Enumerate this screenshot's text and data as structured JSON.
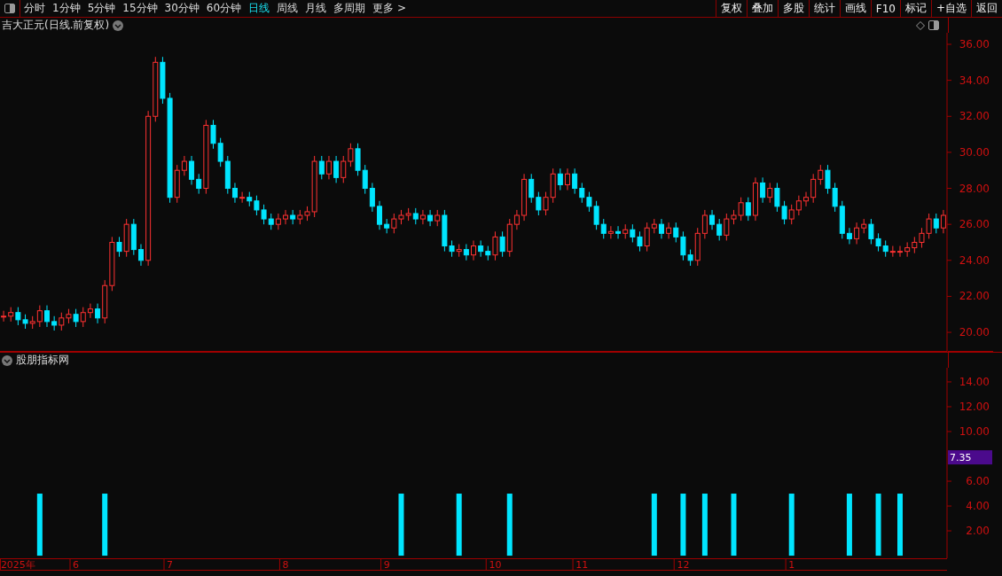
{
  "toolbar": {
    "periods": [
      {
        "label": "分时",
        "selected": false
      },
      {
        "label": "1分钟",
        "selected": false
      },
      {
        "label": "5分钟",
        "selected": false
      },
      {
        "label": "15分钟",
        "selected": false
      },
      {
        "label": "30分钟",
        "selected": false
      },
      {
        "label": "60分钟",
        "selected": false
      },
      {
        "label": "日线",
        "selected": true
      },
      {
        "label": "周线",
        "selected": false
      },
      {
        "label": "月线",
        "selected": false
      },
      {
        "label": "多周期",
        "selected": false
      },
      {
        "label": "更多 >",
        "selected": false
      }
    ],
    "buttons": [
      "复权",
      "叠加",
      "多股",
      "统计",
      "画线",
      "F10",
      "标记",
      "+自选",
      "返回"
    ]
  },
  "price_chart": {
    "title": "吉大正元(日线.前复权)",
    "chart_data": {
      "type": "candlestick",
      "ylim": [
        18.92,
        36.64
      ],
      "yticks": [
        {
          "value": 36,
          "label": "36.00"
        },
        {
          "value": 34,
          "label": "34.00"
        },
        {
          "value": 32,
          "label": "32.00"
        },
        {
          "value": 30,
          "label": "30.00"
        },
        {
          "value": 28,
          "label": "28.00"
        },
        {
          "value": 26,
          "label": "26.00"
        },
        {
          "value": 24,
          "label": "24.00"
        },
        {
          "value": 22,
          "label": "22.00"
        },
        {
          "value": 20,
          "label": "20.00"
        }
      ],
      "categories": [
        null,
        null,
        null,
        null,
        null,
        null,
        null,
        null,
        null,
        null,
        null,
        null,
        null,
        null,
        null,
        null,
        null,
        null,
        null,
        null,
        null,
        null,
        null,
        null,
        null,
        null,
        null,
        null,
        null,
        null,
        null,
        null,
        null,
        null,
        null,
        null,
        null,
        null,
        null,
        null,
        null,
        null,
        null,
        null,
        null,
        null,
        null,
        null,
        null,
        null,
        null,
        null,
        null,
        null,
        null,
        null,
        null,
        null,
        null,
        null,
        null,
        null,
        null,
        null,
        null,
        null,
        null,
        null,
        null,
        null,
        null,
        null,
        null,
        null,
        null,
        null,
        null,
        null,
        null,
        null,
        null,
        null,
        null,
        null,
        null,
        null,
        null,
        null,
        null,
        null,
        null,
        null,
        null,
        null,
        null,
        null,
        null,
        null,
        null,
        null,
        null,
        null,
        null,
        null,
        null,
        null,
        null,
        null,
        null,
        null,
        null,
        null,
        null,
        null,
        null,
        null,
        null,
        null,
        null,
        null,
        null,
        null,
        null,
        null,
        null,
        null,
        null,
        null,
        null,
        null,
        null
      ],
      "ohlc": [
        [
          20.9,
          21.2,
          20.6,
          20.9
        ],
        [
          20.9,
          21.4,
          20.6,
          21.1
        ],
        [
          21.1,
          21.4,
          20.4,
          20.7
        ],
        [
          20.7,
          21.0,
          20.2,
          20.5
        ],
        [
          20.5,
          20.9,
          20.2,
          20.6
        ],
        [
          20.6,
          21.5,
          20.3,
          21.2
        ],
        [
          21.2,
          21.5,
          20.3,
          20.6
        ],
        [
          20.6,
          20.9,
          20.1,
          20.4
        ],
        [
          20.4,
          21.1,
          20.1,
          20.8
        ],
        [
          20.8,
          21.3,
          20.5,
          21.0
        ],
        [
          21.0,
          21.3,
          20.3,
          20.6
        ],
        [
          20.6,
          21.4,
          20.3,
          21.1
        ],
        [
          21.1,
          21.6,
          20.8,
          21.3
        ],
        [
          21.3,
          21.6,
          20.5,
          20.8
        ],
        [
          20.8,
          22.9,
          20.5,
          22.6
        ],
        [
          22.6,
          25.3,
          22.3,
          25.0
        ],
        [
          25.0,
          25.3,
          24.2,
          24.5
        ],
        [
          24.5,
          26.3,
          24.2,
          26.0
        ],
        [
          26.0,
          26.3,
          24.3,
          24.6
        ],
        [
          24.6,
          24.9,
          23.7,
          24.0
        ],
        [
          24.0,
          32.3,
          23.7,
          32.0
        ],
        [
          32.0,
          35.3,
          31.7,
          35.0
        ],
        [
          35.0,
          35.3,
          32.7,
          33.0
        ],
        [
          33.0,
          33.3,
          27.2,
          27.5
        ],
        [
          27.5,
          29.3,
          27.2,
          29.0
        ],
        [
          29.0,
          29.8,
          28.7,
          29.5
        ],
        [
          29.5,
          29.8,
          28.2,
          28.5
        ],
        [
          28.5,
          28.8,
          27.7,
          28.0
        ],
        [
          28.0,
          31.8,
          27.7,
          31.5
        ],
        [
          31.5,
          31.8,
          30.2,
          30.5
        ],
        [
          30.5,
          30.8,
          29.2,
          29.5
        ],
        [
          29.5,
          29.8,
          27.7,
          28.0
        ],
        [
          28.0,
          28.3,
          27.2,
          27.5
        ],
        [
          27.5,
          27.8,
          27.2,
          27.5
        ],
        [
          27.5,
          27.8,
          27.0,
          27.3
        ],
        [
          27.3,
          27.6,
          26.5,
          26.8
        ],
        [
          26.8,
          27.1,
          26.0,
          26.3
        ],
        [
          26.3,
          26.6,
          25.7,
          26.0
        ],
        [
          26.0,
          26.6,
          25.7,
          26.3
        ],
        [
          26.3,
          26.8,
          26.0,
          26.5
        ],
        [
          26.5,
          26.8,
          26.0,
          26.3
        ],
        [
          26.3,
          26.8,
          26.0,
          26.5
        ],
        [
          26.5,
          27.0,
          26.2,
          26.7
        ],
        [
          26.7,
          29.8,
          26.4,
          29.5
        ],
        [
          29.5,
          29.8,
          28.5,
          28.8
        ],
        [
          28.8,
          29.8,
          28.5,
          29.5
        ],
        [
          29.5,
          29.8,
          28.3,
          28.6
        ],
        [
          28.6,
          29.8,
          28.3,
          29.5
        ],
        [
          29.5,
          30.5,
          29.2,
          30.2
        ],
        [
          30.2,
          30.5,
          28.7,
          29.0
        ],
        [
          29.0,
          29.3,
          27.7,
          28.0
        ],
        [
          28.0,
          28.3,
          26.7,
          27.0
        ],
        [
          27.0,
          27.3,
          25.7,
          26.0
        ],
        [
          26.0,
          26.3,
          25.5,
          25.8
        ],
        [
          25.8,
          26.6,
          25.5,
          26.3
        ],
        [
          26.3,
          26.8,
          26.0,
          26.5
        ],
        [
          26.5,
          26.9,
          26.2,
          26.6
        ],
        [
          26.6,
          26.9,
          26.0,
          26.3
        ],
        [
          26.3,
          26.8,
          26.0,
          26.5
        ],
        [
          26.5,
          26.8,
          25.9,
          26.2
        ],
        [
          26.2,
          26.8,
          25.9,
          26.5
        ],
        [
          26.5,
          26.8,
          24.5,
          24.8
        ],
        [
          24.8,
          25.1,
          24.2,
          24.5
        ],
        [
          24.5,
          24.9,
          24.2,
          24.6
        ],
        [
          24.6,
          24.9,
          24.0,
          24.3
        ],
        [
          24.3,
          25.1,
          24.0,
          24.8
        ],
        [
          24.8,
          25.1,
          24.2,
          24.5
        ],
        [
          24.5,
          24.8,
          24.0,
          24.3
        ],
        [
          24.3,
          25.6,
          24.0,
          25.3
        ],
        [
          25.3,
          25.6,
          24.2,
          24.5
        ],
        [
          24.5,
          26.3,
          24.2,
          26.0
        ],
        [
          26.0,
          26.8,
          25.7,
          26.5
        ],
        [
          26.5,
          28.8,
          26.2,
          28.5
        ],
        [
          28.5,
          28.8,
          27.2,
          27.5
        ],
        [
          27.5,
          27.8,
          26.5,
          26.8
        ],
        [
          26.8,
          27.8,
          26.5,
          27.5
        ],
        [
          27.5,
          29.1,
          27.2,
          28.8
        ],
        [
          28.8,
          29.1,
          27.9,
          28.2
        ],
        [
          28.2,
          29.1,
          27.9,
          28.8
        ],
        [
          28.8,
          29.1,
          27.7,
          28.0
        ],
        [
          28.0,
          28.3,
          27.2,
          27.5
        ],
        [
          27.5,
          27.8,
          26.7,
          27.0
        ],
        [
          27.0,
          27.3,
          25.7,
          26.0
        ],
        [
          26.0,
          26.3,
          25.2,
          25.5
        ],
        [
          25.5,
          25.9,
          25.2,
          25.6
        ],
        [
          25.6,
          25.9,
          25.2,
          25.5
        ],
        [
          25.5,
          26.0,
          25.2,
          25.7
        ],
        [
          25.7,
          26.0,
          25.0,
          25.3
        ],
        [
          25.3,
          25.6,
          24.5,
          24.8
        ],
        [
          24.8,
          26.1,
          24.5,
          25.8
        ],
        [
          25.8,
          26.3,
          25.5,
          26.0
        ],
        [
          26.0,
          26.3,
          25.2,
          25.5
        ],
        [
          25.5,
          26.1,
          25.2,
          25.8
        ],
        [
          25.8,
          26.1,
          25.0,
          25.3
        ],
        [
          25.3,
          25.6,
          24.0,
          24.3
        ],
        [
          24.3,
          24.6,
          23.7,
          24.0
        ],
        [
          24.0,
          25.8,
          23.7,
          25.5
        ],
        [
          25.5,
          26.8,
          25.2,
          26.5
        ],
        [
          26.5,
          26.8,
          25.7,
          26.0
        ],
        [
          26.0,
          26.3,
          25.1,
          25.4
        ],
        [
          25.4,
          26.6,
          25.1,
          26.3
        ],
        [
          26.3,
          26.8,
          26.0,
          26.5
        ],
        [
          26.5,
          27.5,
          26.2,
          27.2
        ],
        [
          27.2,
          27.5,
          26.2,
          26.5
        ],
        [
          26.5,
          28.6,
          26.2,
          28.3
        ],
        [
          28.3,
          28.6,
          27.2,
          27.5
        ],
        [
          27.5,
          28.3,
          27.2,
          28.0
        ],
        [
          28.0,
          28.3,
          26.7,
          27.0
        ],
        [
          27.0,
          27.3,
          26.0,
          26.3
        ],
        [
          26.3,
          27.1,
          26.0,
          26.8
        ],
        [
          26.8,
          27.6,
          26.5,
          27.3
        ],
        [
          27.3,
          27.8,
          27.0,
          27.5
        ],
        [
          27.5,
          28.8,
          27.2,
          28.5
        ],
        [
          28.5,
          29.3,
          28.2,
          29.0
        ],
        [
          29.0,
          29.3,
          27.7,
          28.0
        ],
        [
          28.0,
          28.3,
          26.7,
          27.0
        ],
        [
          27.0,
          27.3,
          25.2,
          25.5
        ],
        [
          25.5,
          25.8,
          24.9,
          25.2
        ],
        [
          25.2,
          26.1,
          24.9,
          25.8
        ],
        [
          25.8,
          26.3,
          25.5,
          26.0
        ],
        [
          26.0,
          26.3,
          24.9,
          25.2
        ],
        [
          25.2,
          25.5,
          24.5,
          24.8
        ],
        [
          24.8,
          25.1,
          24.2,
          24.5
        ],
        [
          24.5,
          24.8,
          24.2,
          24.5
        ],
        [
          24.5,
          24.8,
          24.2,
          24.5
        ],
        [
          24.5,
          25.0,
          24.2,
          24.7
        ],
        [
          24.7,
          25.3,
          24.4,
          25.0
        ],
        [
          25.0,
          25.8,
          24.7,
          25.5
        ],
        [
          25.5,
          26.6,
          25.2,
          26.3
        ],
        [
          26.3,
          26.6,
          25.5,
          25.8
        ],
        [
          25.8,
          26.8,
          25.5,
          26.5
        ]
      ]
    }
  },
  "indicator": {
    "current_value": "7.35",
    "chart_data": {
      "type": "bar",
      "ylim": [
        -0.21,
        15.14
      ],
      "yticks": [
        {
          "value": 2,
          "label": "2.00"
        },
        {
          "value": 4,
          "label": "4.00"
        },
        {
          "value": 6,
          "label": "6.00"
        },
        {
          "value": 10,
          "label": "10.00"
        },
        {
          "value": 12,
          "label": "12.00"
        },
        {
          "value": 14,
          "label": "14.00"
        }
      ],
      "categories": [
        null,
        null,
        "2025年",
        null,
        null,
        null,
        null,
        null,
        null,
        null,
        "6",
        null,
        null,
        null,
        null,
        null,
        null,
        null,
        null,
        null,
        null,
        null,
        null,
        "7",
        null,
        null,
        null,
        null,
        null,
        null,
        null,
        null,
        null,
        null,
        null,
        null,
        null,
        null,
        null,
        "8",
        null,
        null,
        null,
        null,
        null,
        null,
        null,
        null,
        null,
        null,
        null,
        null,
        null,
        "9",
        null,
        null,
        null,
        null,
        null,
        null,
        null,
        null,
        null,
        null,
        null,
        null,
        null,
        null,
        "10",
        null,
        null,
        null,
        null,
        null,
        null,
        null,
        null,
        null,
        null,
        null,
        "11",
        null,
        null,
        null,
        null,
        null,
        null,
        null,
        null,
        null,
        null,
        null,
        null,
        null,
        "12",
        null,
        null,
        null,
        null,
        null,
        null,
        null,
        null,
        null,
        null,
        null,
        null,
        null,
        null,
        "1",
        null,
        null,
        null,
        null,
        null,
        null,
        null,
        null,
        null,
        null,
        null,
        null,
        null,
        null,
        null,
        null,
        null,
        null,
        null,
        null,
        null
      ],
      "series": [
        {
          "name": "股朋指标网",
          "color": "#00e5ff",
          "values": [
            null,
            null,
            null,
            null,
            null,
            5,
            null,
            null,
            null,
            null,
            null,
            null,
            null,
            null,
            5,
            null,
            null,
            null,
            null,
            null,
            null,
            null,
            null,
            null,
            null,
            null,
            null,
            null,
            null,
            null,
            null,
            null,
            null,
            null,
            null,
            null,
            null,
            null,
            null,
            null,
            null,
            null,
            null,
            null,
            null,
            null,
            null,
            null,
            null,
            null,
            null,
            null,
            null,
            null,
            null,
            5,
            null,
            null,
            null,
            null,
            null,
            null,
            null,
            5,
            null,
            null,
            null,
            null,
            null,
            null,
            5,
            null,
            null,
            null,
            null,
            null,
            null,
            null,
            null,
            null,
            null,
            null,
            null,
            null,
            null,
            null,
            null,
            null,
            null,
            null,
            5,
            null,
            null,
            null,
            5,
            null,
            null,
            5,
            null,
            null,
            null,
            5,
            null,
            null,
            null,
            null,
            null,
            null,
            null,
            5,
            null,
            null,
            null,
            null,
            null,
            null,
            null,
            5,
            null,
            null,
            null,
            5,
            null,
            null,
            5,
            null,
            null,
            null,
            null,
            null,
            null
          ]
        }
      ]
    }
  }
}
